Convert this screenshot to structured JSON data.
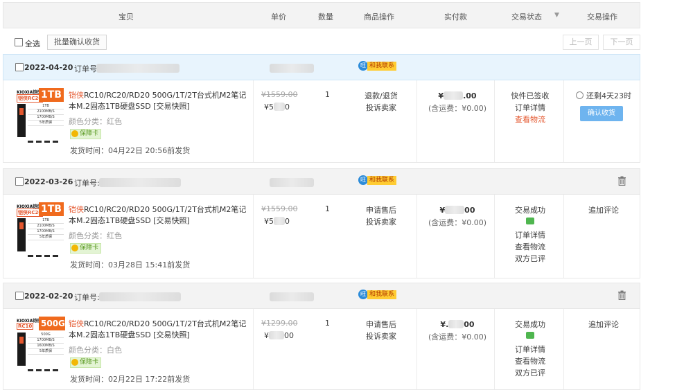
{
  "header": {
    "col_item": "宝贝",
    "col_price": "单价",
    "col_qty": "数量",
    "col_ops": "商品操作",
    "col_paid": "实付款",
    "col_status": "交易状态",
    "col_action": "交易操作"
  },
  "toolbar": {
    "select_all": "全选",
    "batch_confirm": "批量确认收货",
    "prev_page": "上一页",
    "next_page": "下一页"
  },
  "orders": [
    {
      "date": "2022-04-20",
      "order_label": "订单号",
      "contact": "和我联系",
      "thumb_brand": "KIOXIA铠侠",
      "thumb_model": "铠侠RC20",
      "thumb_cap": "1TB",
      "thumb_specs": [
        "1TB",
        "2100MB/S",
        "1700MB/S",
        "5年质保"
      ],
      "title_hl": "铠侠",
      "title_rest": "RC10/RC20/RD20 500G/1T/2T台式机M2笔记本M.2固态1TB硬盘SSD [交易快照]",
      "color": "颜色分类：红色",
      "badge": "保障卡",
      "ship": "发货时间：04月22日 20:56前发货",
      "orig_price": "¥1559.00",
      "price_pre": "¥5",
      "price_post": "0",
      "qty": "1",
      "ops": [
        "退款/退货",
        "投诉卖家"
      ],
      "paid_pre": "¥",
      "paid_post": ".00",
      "paid_ship": "(含运费：¥0.00)",
      "status": [
        "快件已签收",
        "订单详情"
      ],
      "status_red": "查看物流",
      "remain": "还剩4天23时",
      "confirm": "确认收货"
    },
    {
      "date": "2022-03-26",
      "order_label": "订单号:",
      "contact": "和我联系",
      "thumb_brand": "KIOXIA铠侠",
      "thumb_model": "铠侠RC20",
      "thumb_cap": "1TB",
      "thumb_specs": [
        "1TB",
        "2100MB/S",
        "1700MB/S",
        "5年质保"
      ],
      "title_hl": "铠侠",
      "title_rest": "RC10/RC20/RD20 500G/1T/2T台式机M2笔记本M.2固态1TB硬盘SSD [交易快照]",
      "color": "颜色分类：红色",
      "badge": "保障卡",
      "ship": "发货时间：03月28日 15:41前发货",
      "orig_price": "¥1559.00",
      "price_pre": "¥5",
      "price_post": "0",
      "qty": "1",
      "ops": [
        "申请售后",
        "投诉卖家"
      ],
      "paid_pre": "¥",
      "paid_post": "00",
      "paid_ship": "(含运费：¥0.00)",
      "status_top": "交易成功",
      "status_after": [
        "订单详情",
        "查看物流",
        "双方已评"
      ],
      "action": "追加评论"
    },
    {
      "date": "2022-02-20",
      "order_label": "订单号:",
      "contact": "和我联系",
      "thumb_brand": "KIOXIA铠侠",
      "thumb_model": "RC10",
      "thumb_cap": "500G",
      "thumb_specs": [
        "500G",
        "1700MB/S",
        "1600MB/S",
        "5年质保"
      ],
      "title_hl": "铠侠",
      "title_rest": "RC10/RC20/RD20 500G/1T/2T台式机M2笔记本M.2固态1TB硬盘SSD [交易快照]",
      "color": "颜色分类：白色",
      "badge": "保障卡",
      "ship": "发货时间：02月22日 17:22前发货",
      "orig_price": "¥1299.00",
      "price_pre": "¥",
      "price_post": "00",
      "qty": "1",
      "ops": [
        "申请售后",
        "投诉卖家"
      ],
      "paid_pre": "¥.",
      "paid_post": "00",
      "paid_ship": "(含运费：¥0.00)",
      "status_top": "交易成功",
      "status_after": [
        "订单详情",
        "查看物流",
        "双方已评"
      ],
      "action": "追加评论"
    }
  ],
  "colors": {
    "accent_red": "#e4572e",
    "confirm_blue": "#6eb4ef",
    "header_blue": "#e8f4fd"
  }
}
